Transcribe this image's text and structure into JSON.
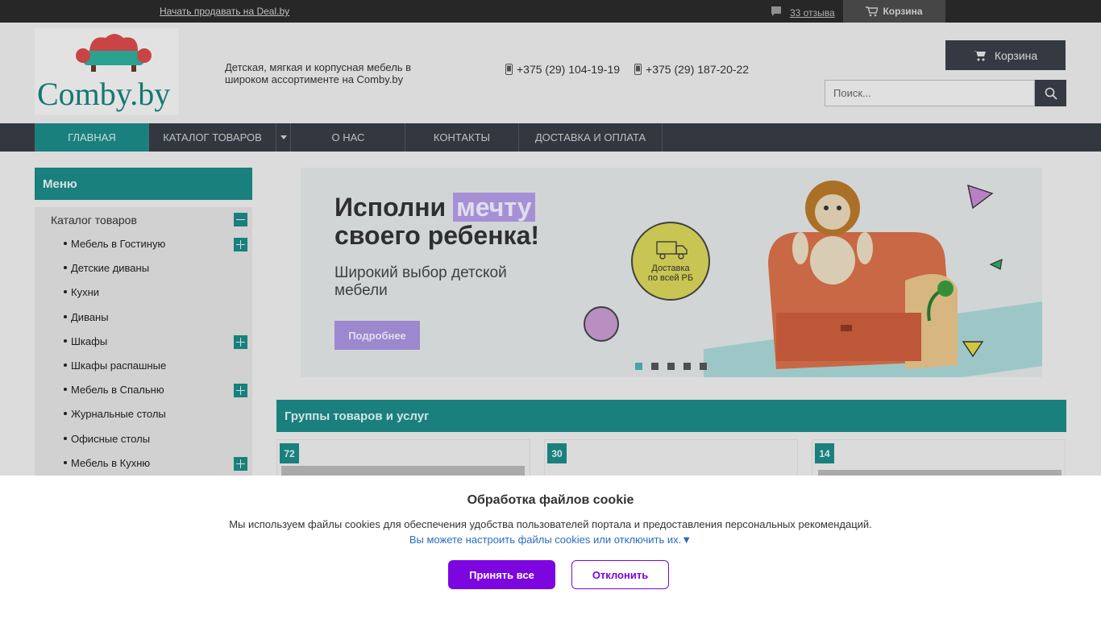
{
  "topbar": {
    "sell_link": "Начать продавать на Deal.by",
    "reviews": "33 отзыва",
    "cart": "Корзина"
  },
  "header": {
    "logo_text": "Comby.by",
    "tagline": "Детская, мягкая и корпусная мебель в широком ассортименте на Comby.by",
    "phones": [
      "+375 (29) 104-19-19",
      "+375 (29) 187-20-22"
    ],
    "cart_button": "Корзина",
    "search_placeholder": "Поиск..."
  },
  "nav": {
    "items": [
      "ГЛАВНАЯ",
      "КАТАЛОГ ТОВАРОВ",
      "О НАС",
      "КОНТАКТЫ",
      "ДОСТАВКА И ОПЛАТА"
    ],
    "active_index": 0
  },
  "sidebar": {
    "heading": "Меню",
    "catalog_title": "Каталог товаров",
    "items": [
      {
        "label": "Мебель в Гостиную",
        "expandable": true
      },
      {
        "label": "Детские диваны",
        "expandable": false
      },
      {
        "label": "Кухни",
        "expandable": false
      },
      {
        "label": "Диваны",
        "expandable": false
      },
      {
        "label": "Шкафы",
        "expandable": true
      },
      {
        "label": "Шкафы распашные",
        "expandable": false
      },
      {
        "label": "Мебель в Спальню",
        "expandable": true
      },
      {
        "label": "Журнальные столы",
        "expandable": false
      },
      {
        "label": "Офисные столы",
        "expandable": false
      },
      {
        "label": "Мебель в Кухню",
        "expandable": true
      }
    ]
  },
  "banner": {
    "title_part1": "Исполни",
    "title_highlight": "мечту",
    "title_line2": "своего ребенка!",
    "subtitle": "Широкий выбор детской мебели",
    "button": "Подробнее",
    "delivery_line1": "Доставка",
    "delivery_line2": "по всей РБ",
    "slide_count": 5,
    "active_slide": 0
  },
  "groups": {
    "heading": "Группы товаров и услуг",
    "cards": [
      {
        "count": "72"
      },
      {
        "count": "30"
      },
      {
        "count": "14"
      }
    ]
  },
  "cookie": {
    "title": "Обработка файлов cookie",
    "text": "Мы используем файлы cookies для обеспечения удобства пользователей портала и предоставления персональных рекомендаций.",
    "link": "Вы можете настроить файлы cookies или отключить их.▼",
    "accept": "Принять все",
    "decline": "Отклонить"
  },
  "colors": {
    "teal": "#1b8a87",
    "dark": "#373c45",
    "accent_purple": "#7c05e0"
  }
}
